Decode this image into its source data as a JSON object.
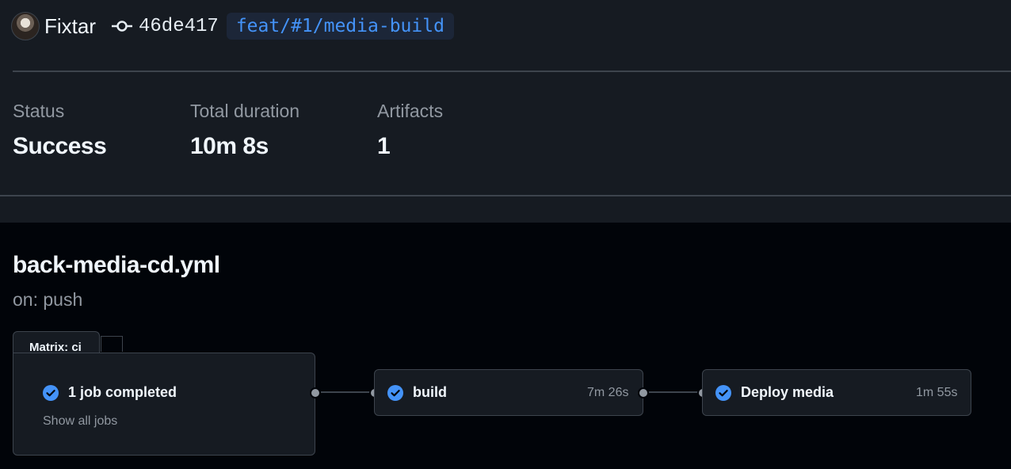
{
  "header": {
    "actor": "Fixtar",
    "commit_sha": "46de417",
    "branch": "feat/#1/media-build"
  },
  "stats": [
    {
      "label": "Status",
      "value": "Success"
    },
    {
      "label": "Total duration",
      "value": "10m 8s"
    },
    {
      "label": "Artifacts",
      "value": "1"
    }
  ],
  "workflow": {
    "file": "back-media-cd.yml",
    "trigger": "on: push"
  },
  "graph": {
    "matrix": {
      "label": "Matrix: ci",
      "summary": "1 job completed",
      "show_all": "Show all jobs"
    },
    "jobs": [
      {
        "name": "build",
        "duration": "7m 26s",
        "status": "success"
      },
      {
        "name": "Deploy media",
        "duration": "1m 55s",
        "status": "success"
      }
    ]
  },
  "colors": {
    "success_icon": "#4493f8",
    "branch_text": "#4493f8",
    "branch_bg": "#1c2638"
  },
  "icons": {
    "commit": "git-commit-icon",
    "check": "check-circle-fill-icon"
  }
}
